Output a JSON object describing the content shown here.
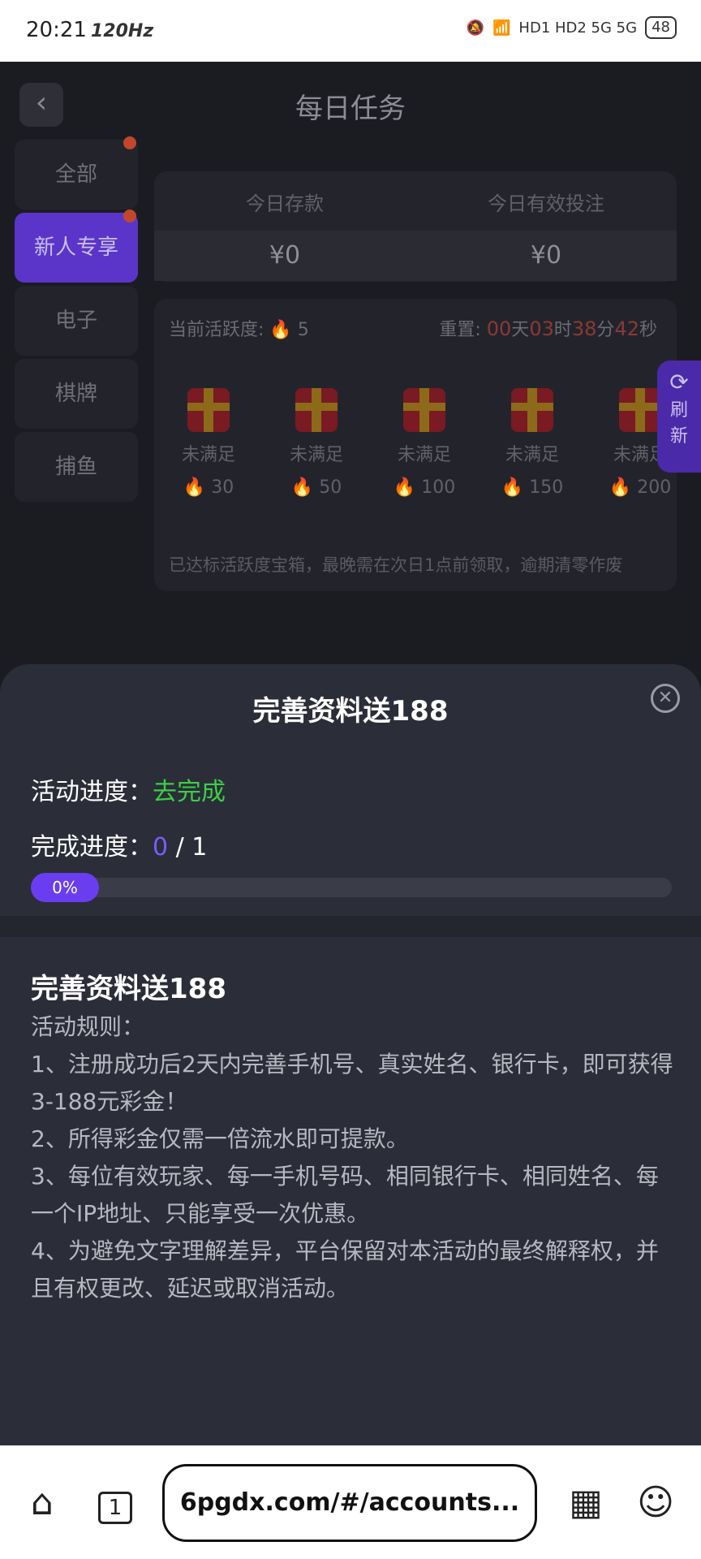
{
  "status_bar": {
    "time": "20:21",
    "refresh": "120Hz",
    "network": "HD1 HD2 5G 5G",
    "battery": "48"
  },
  "header": {
    "title": "每日任务",
    "back_icon": "chevron-left-icon"
  },
  "sidebar": {
    "items": [
      {
        "label": "全部",
        "badge": true,
        "active": false
      },
      {
        "label": "新人专享",
        "badge": true,
        "active": true
      },
      {
        "label": "电子",
        "badge": false,
        "active": false
      },
      {
        "label": "棋牌",
        "badge": false,
        "active": false
      },
      {
        "label": "捕鱼",
        "badge": false,
        "active": false
      }
    ]
  },
  "stats": {
    "deposit_label": "今日存款",
    "deposit_value": "¥0",
    "bet_label": "今日有效投注",
    "bet_value": "¥0"
  },
  "activity": {
    "label": "当前活跃度:",
    "value": "5",
    "reset_label": "重置:",
    "days": "00",
    "days_unit": "天",
    "hours": "03",
    "hours_unit": "时",
    "minutes": "38",
    "minutes_unit": "分",
    "seconds": "42",
    "seconds_unit": "秒",
    "chests": [
      {
        "status": "未满足",
        "points": "30"
      },
      {
        "status": "未满足",
        "points": "50"
      },
      {
        "status": "未满足",
        "points": "100"
      },
      {
        "status": "未满足",
        "points": "150"
      },
      {
        "status": "未满足",
        "points": "200"
      }
    ],
    "note": "已达标活跃度宝箱，最晚需在次日1点前领取，逾期清零作废"
  },
  "refresh": {
    "label_1": "刷",
    "label_2": "新"
  },
  "sheet": {
    "title": "完善资料送188",
    "activity_progress_label": "活动进度：",
    "activity_progress_value": "去完成",
    "completion_label": "完成进度：",
    "completion_current": "0",
    "completion_total": "/ 1",
    "progress": 0,
    "progress_text": "0%",
    "rules_title": "完善资料送188",
    "rules_heading": "活动规则：",
    "rules": [
      "1、注册成功后2天内完善手机号、真实姓名、银行卡，即可获得3-188元彩金！",
      "2、所得彩金仅需一倍流水即可提款。",
      "3、每位有效玩家、每一手机号码、相同银行卡、相同姓名、每一个IP地址、只能享受一次优惠。",
      "4、为避免文字理解差异，平台保留对本活动的最终解释权，并且有权更改、延迟或取消活动。"
    ]
  },
  "browser": {
    "url": "6pgdx.com/#/accounts...",
    "tab_count": "1"
  }
}
